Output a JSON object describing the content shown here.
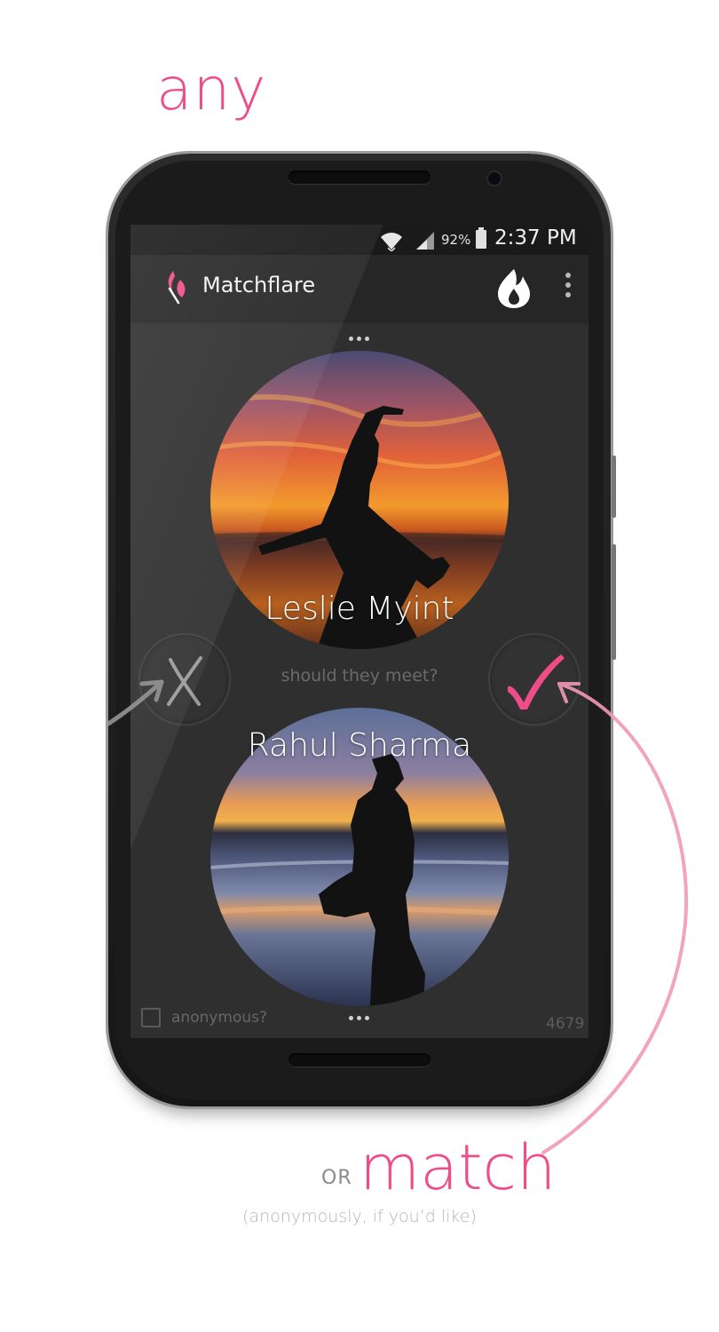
{
  "captions": {
    "top": "any",
    "or": "OR",
    "match": "match",
    "sub": "(anonymously, if you’d like)"
  },
  "statusbar": {
    "battery_percent": "92%",
    "time": "2:37 PM",
    "icons": [
      "wifi-icon",
      "signal-icon",
      "battery-icon"
    ]
  },
  "appbar": {
    "title": "Matchflare",
    "logo_icon": "matchflare-logo-icon",
    "actions": [
      "flame-icon",
      "overflow-menu-icon"
    ]
  },
  "match": {
    "person1": {
      "name": "Leslie Myint",
      "photo": "silhouette-jumping-at-sunset"
    },
    "person2": {
      "name": "Rahul Sharma",
      "photo": "silhouette-on-beach-at-dusk"
    },
    "question": "should they meet?",
    "reject_icon": "x-icon",
    "accept_icon": "checkmark-icon"
  },
  "footer": {
    "anonymous_label": "anonymous?",
    "anonymous_checked": false,
    "count": "4679"
  },
  "colors": {
    "accent": "#ee4d87",
    "screen_bg": "#2f2f2f",
    "appbar_bg": "#262626"
  }
}
